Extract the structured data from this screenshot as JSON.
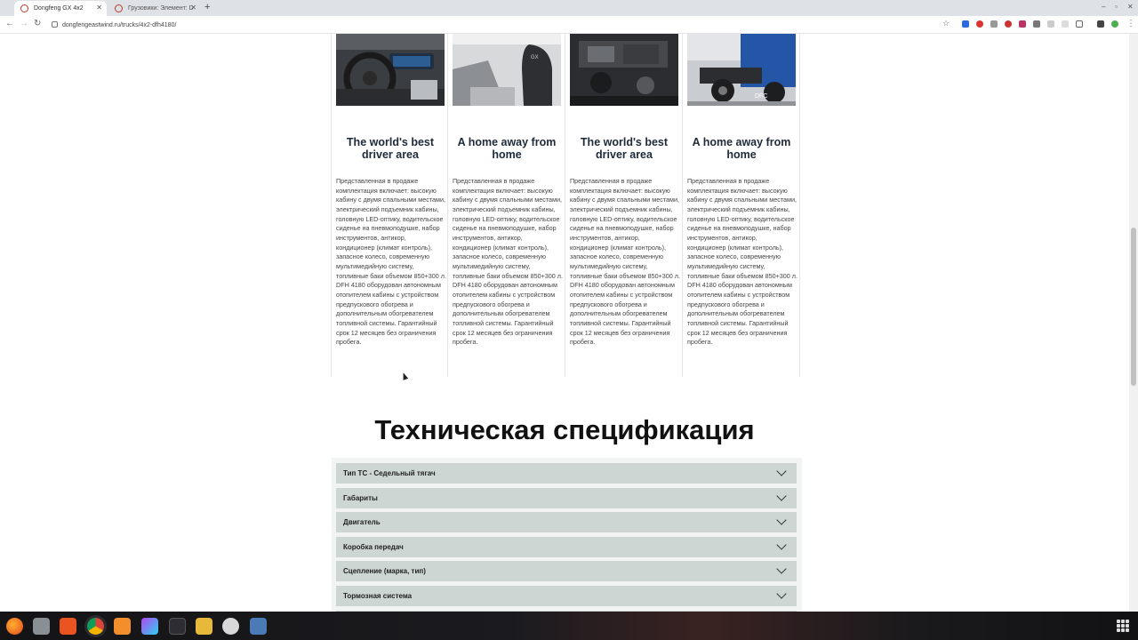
{
  "browser": {
    "tabs": [
      {
        "title": "Dongfeng GX 4x2",
        "active": true
      },
      {
        "title": "Грузовики: Элемент: D",
        "active": false
      }
    ],
    "url": "dongfengeastwind.ru/trucks/4x2-dfh4180/"
  },
  "cards": [
    {
      "title": "The world's best driver area",
      "image": "cockpit-photo",
      "text": "Представленная в продаже комплектация включает: высокую кабину с двумя спальными местами, электрический подъемник кабины, головную LED-оптику, водительское сиденье на пневмоподушке, набор инструментов, антикор, кондиционер (климат контроль), запасное колесо, современную мультимедийную систему, топливные баки объемом 850+300 л. DFH 4180 оборудован автономным отопителем кабины с устройством предпускового обогрева и дополнительным обогревателем топливной системы. Гарантийный срок 12 месяцев без ограничения пробега."
    },
    {
      "title": "A home away from home",
      "image": "seat-photo",
      "text": "Представленная в продаже комплектация включает: высокую кабину с двумя спальными местами, электрический подъемник кабины, головную LED-оптику, водительское сиденье на пневмоподушке, набор инструментов, антикор, кондиционер (климат контроль), запасное колесо, современную мультимедийную систему, топливные баки объемом 850+300 л. DFH 4180 оборудован автономным отопителем кабины с устройством предпускового обогрева и дополнительным обогревателем топливной системы. Гарантийный срок 12 месяцев без ограничения пробега."
    },
    {
      "title": "The world's best driver area",
      "image": "engine-photo",
      "text": "Представленная в продаже комплектация включает: высокую кабину с двумя спальными местами, электрический подъемник кабины, головную LED-оптику, водительское сиденье на пневмоподушке, набор инструментов, антикор, кондиционер (климат контроль), запасное колесо, современную мультимедийную систему, топливные баки объемом 850+300 л. DFH 4180 оборудован автономным отопителем кабины с устройством предпускового обогрева и дополнительным обогревателем топливной системы. Гарантийный срок 12 месяцев без ограничения пробега."
    },
    {
      "title": "A home away from home",
      "image": "truck-rear-photo",
      "text": "Представленная в продаже комплектация включает: высокую кабину с двумя спальными местами, электрический подъемник кабины, головную LED-оптику, водительское сиденье на пневмоподушке, набор инструментов, антикор, кондиционер (климат контроль), запасное колесо, современную мультимедийную систему, топливные баки объемом 850+300 л. DFH 4180 оборудован автономным отопителем кабины с устройством предпускового обогрева и дополнительным обогревателем топливной системы. Гарантийный срок 12 месяцев без ограничения пробега."
    }
  ],
  "spec": {
    "title": "Техническая спецификация",
    "items": [
      "Тип ТС - Седельный тягач",
      "Габариты",
      "Двигатель",
      "Коробка передач",
      "Сцепление (марка, тип)",
      "Тормозная система"
    ]
  },
  "taskbar": {
    "apps": [
      "firefox-icon",
      "files-icon",
      "software-icon",
      "chrome-icon",
      "sublime-icon",
      "phpstorm-icon",
      "terminal-icon",
      "archive-icon",
      "settings-icon",
      "filezilla-icon"
    ]
  }
}
